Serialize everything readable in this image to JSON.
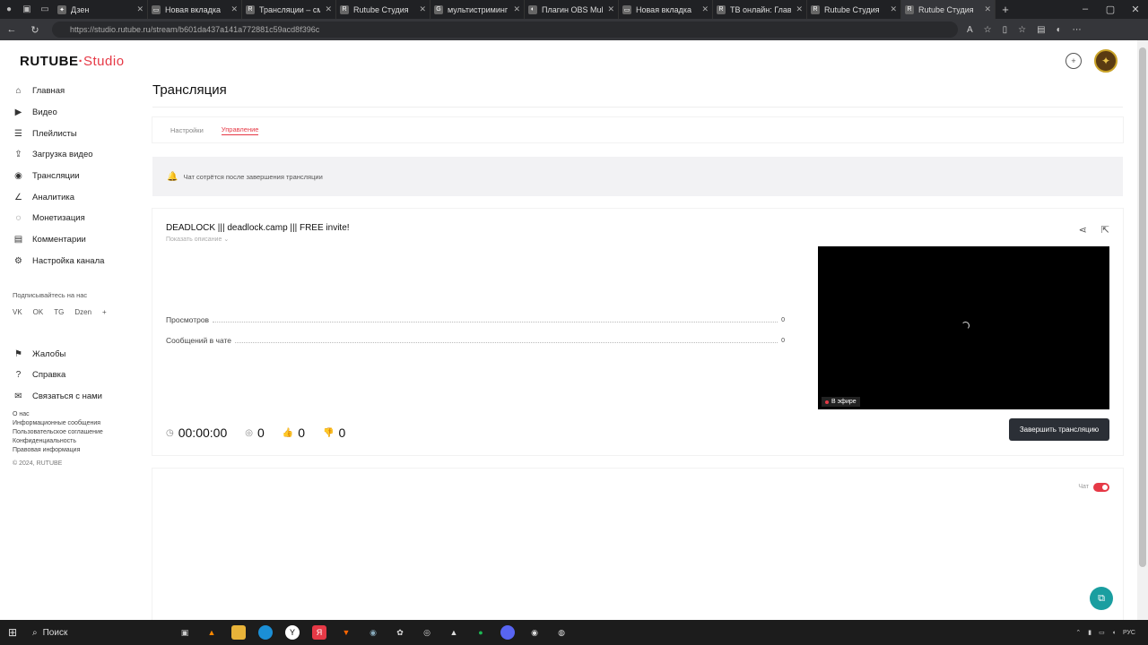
{
  "browser": {
    "tabs": [
      {
        "label": "Дзен",
        "icon": "dzen-icon"
      },
      {
        "label": "Новая вкладка",
        "icon": "tab-icon"
      },
      {
        "label": "Трансляции – смотр",
        "icon": "rutube-icon",
        "active": false
      },
      {
        "label": "Rutube Студия",
        "icon": "rutube-icon"
      },
      {
        "label": "мультистриминг от",
        "icon": "google-icon"
      },
      {
        "label": "Плагин OBS Multip",
        "icon": "obs-icon"
      },
      {
        "label": "Новая вкладка",
        "icon": "tab-icon"
      },
      {
        "label": "ТВ онлайн: Главная",
        "icon": "rutube-icon"
      },
      {
        "label": "Rutube Студия",
        "icon": "rutube-icon"
      },
      {
        "label": "Rutube Студия",
        "icon": "rutube-icon",
        "active": true
      }
    ],
    "url": "https://studio.rutube.ru/stream/b601da437a141a772881c59acd8f396c"
  },
  "logo": {
    "main": "RUTUBE",
    "studio": "Studio"
  },
  "sidebar": {
    "items": [
      {
        "label": "Главная",
        "icon": "home-icon"
      },
      {
        "label": "Видео",
        "icon": "video-icon"
      },
      {
        "label": "Плейлисты",
        "icon": "playlist-icon"
      },
      {
        "label": "Загрузка видео",
        "icon": "upload-icon"
      },
      {
        "label": "Трансляции",
        "icon": "broadcast-icon"
      },
      {
        "label": "Аналитика",
        "icon": "analytics-icon"
      },
      {
        "label": "Монетизация",
        "icon": "money-icon"
      },
      {
        "label": "Комментарии",
        "icon": "comments-icon"
      },
      {
        "label": "Настройка канала",
        "icon": "settings-icon"
      }
    ],
    "follow_label": "Подписывайтесь на нас",
    "socials": [
      "VK",
      "OK",
      "TG",
      "Dzen",
      "+"
    ],
    "lower_items": [
      {
        "label": "Жалобы",
        "icon": "flag-icon"
      },
      {
        "label": "Справка",
        "icon": "help-icon"
      },
      {
        "label": "Связаться с нами",
        "icon": "mail-icon"
      }
    ],
    "footer": [
      "О нас",
      "Информационные сообщения",
      "Пользовательское соглашение",
      "Конфиденциальность",
      "Правовая информация"
    ],
    "copyright": "© 2024, RUTUBE"
  },
  "page": {
    "title": "Трансляция",
    "tabs": {
      "settings": "Настройки",
      "control": "Управление"
    },
    "notice": "Чат сотрётся после завершения трансляции"
  },
  "stream": {
    "title": "DEADLOCK ||| deadlock.camp ||| FREE invite!",
    "show_description": "Показать описание",
    "stats": [
      {
        "label": "Просмотров",
        "value": "0"
      },
      {
        "label": "Сообщений в чате",
        "value": "0"
      }
    ],
    "timer": "00:00:00",
    "viewers": "0",
    "likes": "0",
    "dislikes": "0",
    "live_label": "В эфире",
    "end_button": "Завершить трансляцию"
  },
  "chat": {
    "label": "Чат",
    "enabled": true
  },
  "taskbar": {
    "search": "Поиск",
    "lang": "РУС"
  },
  "colors": {
    "accent": "#e63946",
    "dark_button": "#2b2f36",
    "help": "#1a9ea0"
  }
}
